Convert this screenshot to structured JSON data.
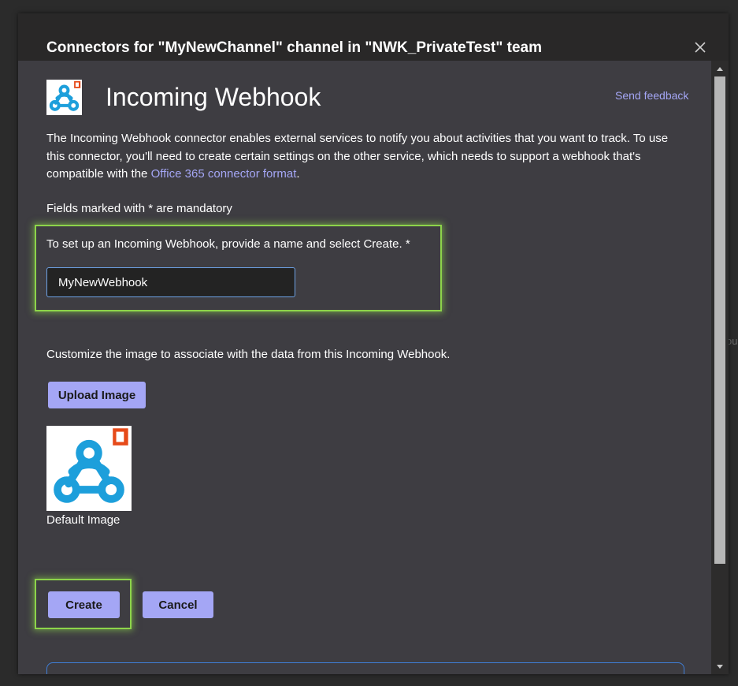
{
  "dialog": {
    "title": "Connectors for \"MyNewChannel\" channel in \"NWK_PrivateTest\" team",
    "close_icon": "close-icon"
  },
  "connector": {
    "name": "Incoming Webhook",
    "logo_icon": "webhook-logo-icon",
    "feedback_label": "Send feedback"
  },
  "description": {
    "text_before_link": "The Incoming Webhook connector enables external services to notify you about activities that you want to track. To use this connector, you'll need to create certain settings on the other service, which needs to support a webhook that's compatible with the ",
    "link_label": "Office 365 connector format",
    "text_after_link": "."
  },
  "form": {
    "mandatory_note": "Fields marked with * are mandatory",
    "name_label": "To set up an Incoming Webhook, provide a name and select Create. *",
    "name_value": "MyNewWebhook",
    "customize_label": "Customize the image to associate with the data from this Incoming Webhook.",
    "upload_label": "Upload Image",
    "default_image_caption": "Default Image"
  },
  "actions": {
    "create_label": "Create",
    "cancel_label": "Cancel"
  },
  "colors": {
    "accent": "#a4a6f5",
    "highlight": "#8dd44a",
    "webhook_blue": "#1d9fdb",
    "office_red": "#e64a19"
  },
  "backdrop": {
    "partial_text": "ou"
  }
}
